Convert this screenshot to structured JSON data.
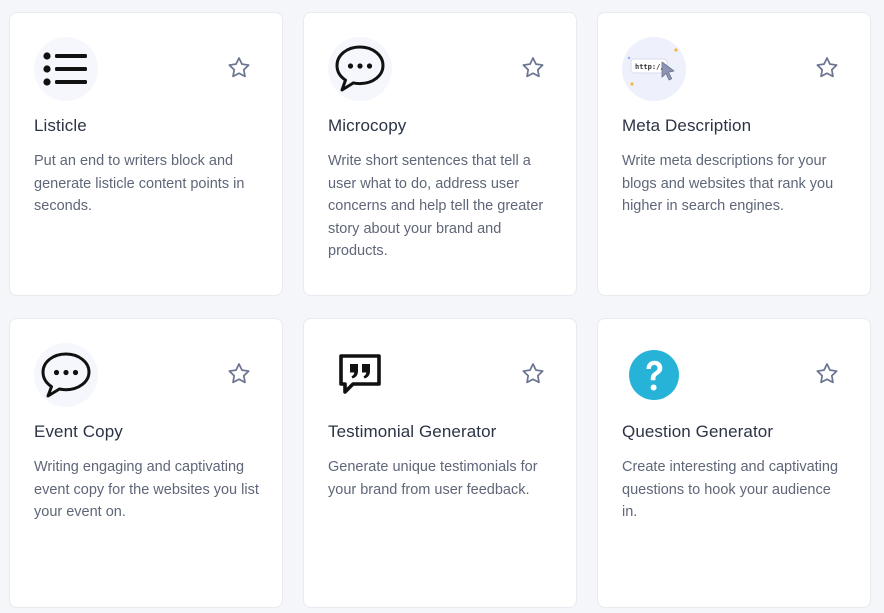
{
  "cards": [
    {
      "title": "Listicle",
      "description": "Put an end to writers block and generate listicle content points in seconds.",
      "icon": "list-icon"
    },
    {
      "title": "Microcopy",
      "description": "Write short sentences that tell a user what to do, address user concerns and help tell the greater story about your brand and products.",
      "icon": "chat-bubble-icon"
    },
    {
      "title": "Meta Description",
      "description": "Write meta descriptions for your blogs and websites that rank you higher in search engines.",
      "icon": "url-cursor-icon",
      "icon_text": "http://"
    },
    {
      "title": "Event Copy",
      "description": "Writing engaging and captivating event copy for the websites you list your event on.",
      "icon": "chat-bubble-icon"
    },
    {
      "title": "Testimonial Generator",
      "description": "Generate unique testimonials for your brand from user feedback.",
      "icon": "quote-bubble-icon"
    },
    {
      "title": "Question Generator",
      "description": "Create interesting and captivating questions to hook your audience in.",
      "icon": "question-mark-icon"
    }
  ],
  "colors": {
    "title": "#2b3445",
    "description": "#5e6678",
    "star": "#6b7590",
    "question_icon": "#27b3d8"
  }
}
